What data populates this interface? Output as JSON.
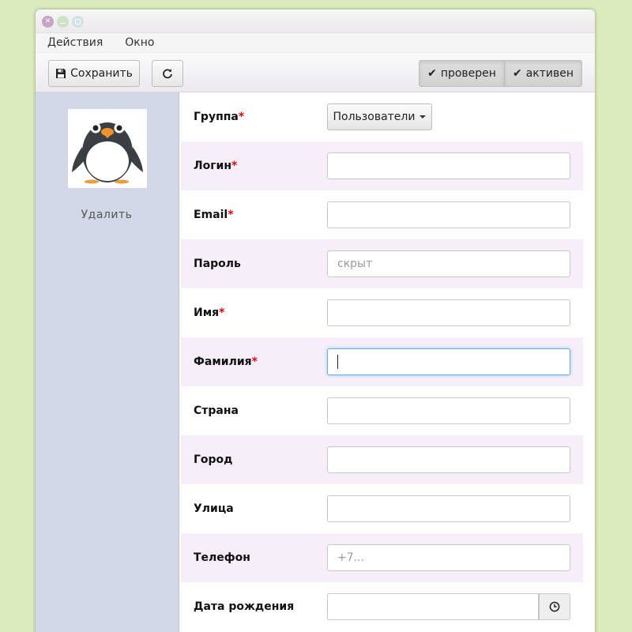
{
  "menu": {
    "items": [
      {
        "label": "Действия"
      },
      {
        "label": "Окно"
      }
    ]
  },
  "toolbar": {
    "save_label": "Сохранить",
    "toggles": [
      {
        "label": "проверен",
        "active": true
      },
      {
        "label": "активен",
        "active": true
      }
    ]
  },
  "sidebar": {
    "delete_label": "Удалить"
  },
  "form": {
    "group": {
      "label": "Группа",
      "required": "*",
      "value": "Пользователи"
    },
    "login": {
      "label": "Логин",
      "required": "*",
      "value": ""
    },
    "email": {
      "label": "Email",
      "required": "*",
      "value": ""
    },
    "password": {
      "label": "Пароль",
      "placeholder": "скрыт"
    },
    "first_name": {
      "label": "Имя",
      "required": "*",
      "value": ""
    },
    "last_name": {
      "label": "Фамилия",
      "required": "*",
      "value": ""
    },
    "country": {
      "label": "Страна",
      "value": ""
    },
    "city": {
      "label": "Город",
      "value": ""
    },
    "street": {
      "label": "Улица",
      "value": ""
    },
    "phone": {
      "label": "Телефон",
      "placeholder": "+7..."
    },
    "birthdate": {
      "label": "Дата рождения",
      "value": ""
    }
  },
  "icons": {
    "save": "floppy-disk-icon",
    "reload": "refresh-icon",
    "check": "check-icon",
    "clock": "clock-icon",
    "avatar": "penguin-avatar"
  },
  "colors": {
    "background": "#dcebbd",
    "sidebar": "#d3d8e8",
    "row_alt": "#f6eff9",
    "required": "#ee0000",
    "focus": "#66afe9"
  }
}
